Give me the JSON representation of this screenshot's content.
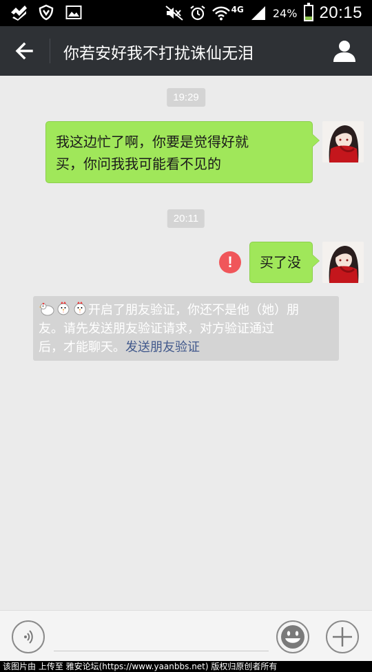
{
  "status_bar": {
    "network": "4G",
    "battery_percent": "24%",
    "battery_level": 0.24,
    "time": "20:15",
    "icons": [
      "check-app-icon",
      "shield-icon",
      "image-icon",
      "mute-icon",
      "alarm-icon",
      "wifi-icon",
      "signal-icon",
      "battery-icon"
    ]
  },
  "header": {
    "title": "你若安好我不打扰诛仙无泪",
    "back_icon": "arrow-left-icon",
    "profile_icon": "person-icon"
  },
  "messages": [
    {
      "type": "time",
      "text": "19:29"
    },
    {
      "type": "sent",
      "lines": [
        "我这边忙了啊，你要是觉得好就",
        "买，你问我我可能看不见的"
      ]
    },
    {
      "type": "time",
      "text": "20:11"
    },
    {
      "type": "sent",
      "lines": [
        "买了没"
      ],
      "failed": true,
      "failed_icon": "!"
    }
  ],
  "system_notice": {
    "line1": "开启了朋友验证，你还不是他（她）朋",
    "line2": "友。请先发送朋友验证请求，对方验证通过",
    "line3_text": "后，才能聊天。",
    "link": "发送朋友验证"
  },
  "input_bar": {
    "voice_icon": "voice-icon",
    "emoji_icon": "smiley-icon",
    "plus_icon": "plus-icon"
  },
  "watermark": "该图片由  上传至 雅安论坛(https://www.yaanbbs.net) 版权归原创者所有",
  "colors": {
    "header_bg": "#2e3135",
    "bubble_green": "#a0e75a",
    "chat_bg": "#ebebeb",
    "error_red": "#f0565a",
    "link_blue": "#42598c"
  }
}
